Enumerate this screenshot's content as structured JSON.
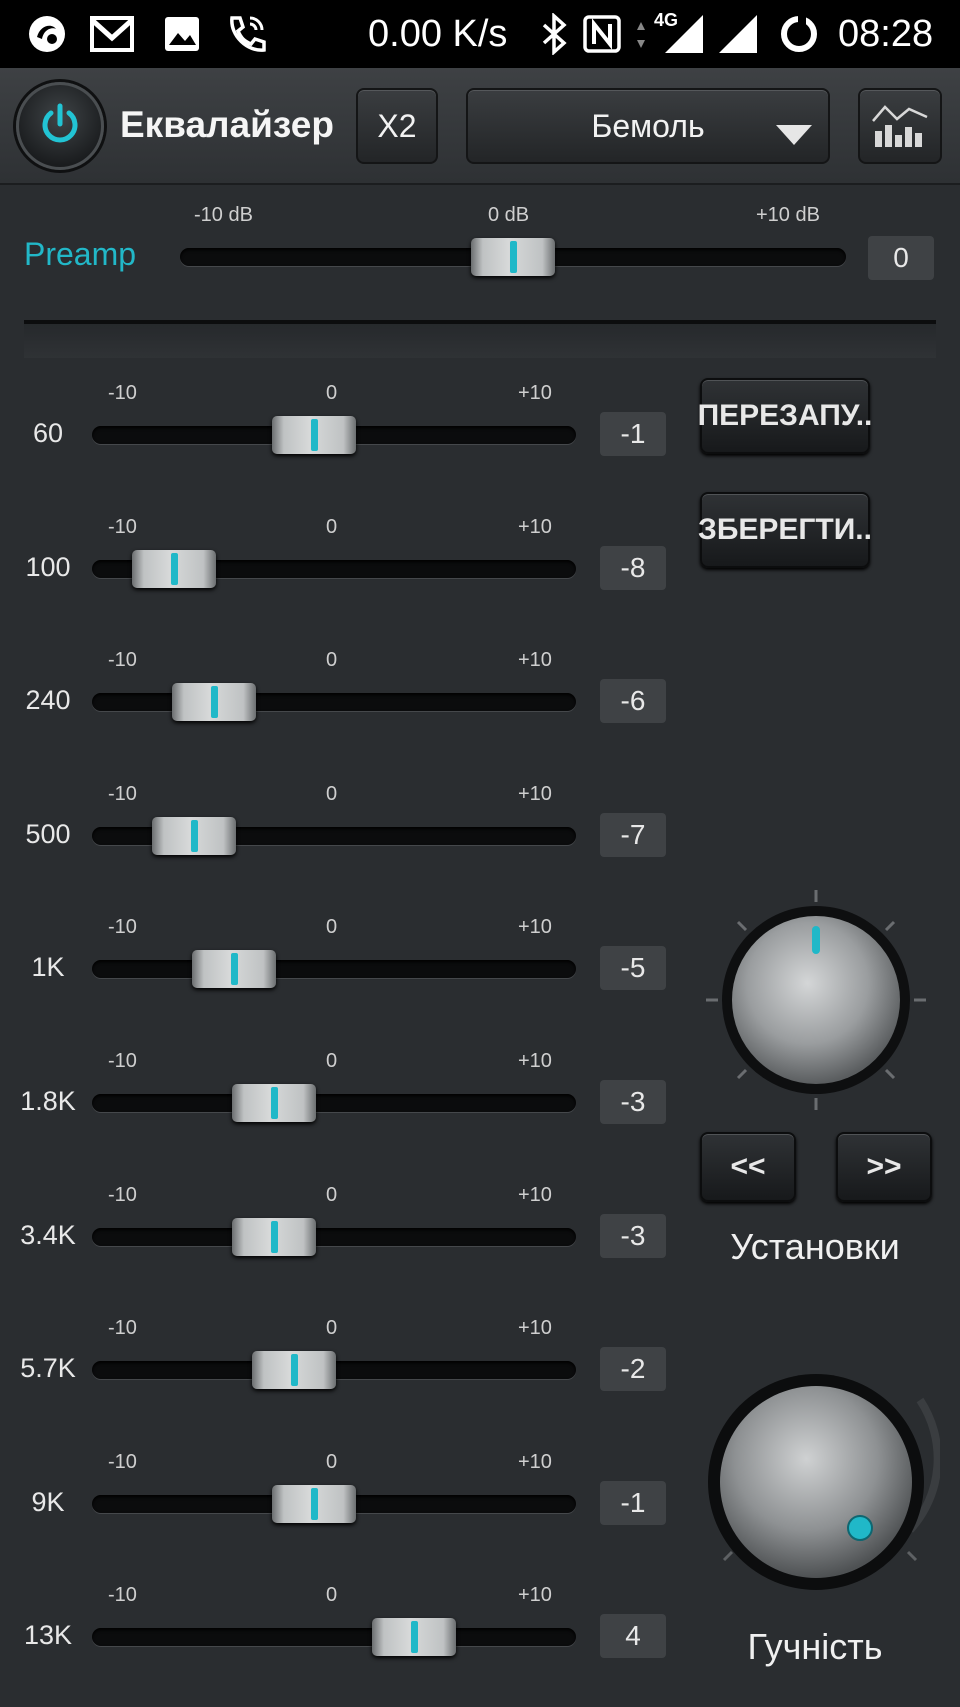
{
  "status_bar": {
    "net_speed": "0.00 K/s",
    "network_type": "4G",
    "time": "08:28",
    "icons": [
      "app-icon",
      "gmail-icon",
      "gallery-icon",
      "wifi-calling-icon",
      "bluetooth-icon",
      "nfc-icon",
      "data-arrows-icon",
      "signal-icon",
      "signal-icon",
      "sync-icon"
    ]
  },
  "header": {
    "title": "Еквалайзер",
    "x2_label": "X2",
    "preset_value": "Бемоль",
    "icons": [
      "power-icon",
      "dropdown-arrow-icon",
      "spectrum-graph-icon"
    ]
  },
  "preamp": {
    "label": "Preamp",
    "tick_min": "-10 dB",
    "tick_mid": "0 dB",
    "tick_max": "+10 dB",
    "value": 0,
    "display": "0"
  },
  "band_ticks": {
    "min": "-10",
    "mid": "0",
    "max": "+10"
  },
  "bands": [
    {
      "label": "60",
      "value": -1,
      "display": "-1"
    },
    {
      "label": "100",
      "value": -8,
      "display": "-8"
    },
    {
      "label": "240",
      "value": -6,
      "display": "-6"
    },
    {
      "label": "500",
      "value": -7,
      "display": "-7"
    },
    {
      "label": "1K",
      "value": -5,
      "display": "-5"
    },
    {
      "label": "1.8K",
      "value": -3,
      "display": "-3"
    },
    {
      "label": "3.4K",
      "value": -3,
      "display": "-3"
    },
    {
      "label": "5.7K",
      "value": -2,
      "display": "-2"
    },
    {
      "label": "9K",
      "value": -1,
      "display": "-1"
    },
    {
      "label": "13K",
      "value": 4,
      "display": "4"
    }
  ],
  "buttons": {
    "reset": "ПЕРЕЗАПУ..",
    "save": "ЗБЕРЕГТИ..",
    "prev": "<<",
    "next": ">>"
  },
  "knobs": {
    "settings_label": "Установки",
    "volume_label": "Гучність"
  },
  "colors": {
    "accent": "#20b8c8",
    "background": "#2a2d30"
  }
}
